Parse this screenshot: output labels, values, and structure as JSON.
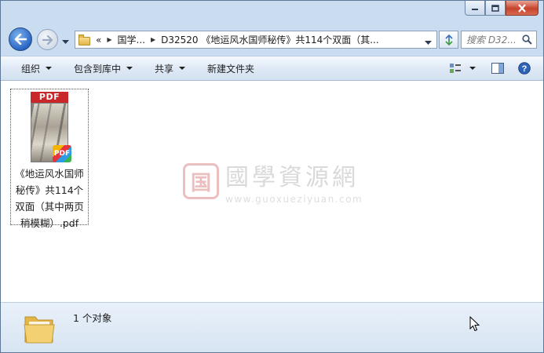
{
  "window": {
    "caption_icons": [
      "minimize-icon",
      "maximize-icon",
      "close-icon"
    ]
  },
  "nav": {
    "breadcrumb_overflow": "«",
    "crumbs": [
      "国学...",
      "D32520 《地运风水国师秘传》共114个双面（其..."
    ],
    "search_placeholder": "搜索 D32..."
  },
  "toolbar": {
    "organize": "组织",
    "include_in_library": "包含到库中",
    "share": "共享",
    "new_folder": "新建文件夹"
  },
  "files": [
    {
      "name": "《地运风水国师秘传》共114个双面（其中两页稍模糊）.pdf",
      "thumb_header": "PDF",
      "badge": "PDF"
    }
  ],
  "watermark": {
    "seal_char": "国",
    "cn": "國學資源網",
    "url": "www.guoxueziyuan.com"
  },
  "status": {
    "text": "1 个对象"
  },
  "colors": {
    "accent": "#2a66c4",
    "pdf_red": "#c8282a",
    "close_red": "#c7432c"
  }
}
